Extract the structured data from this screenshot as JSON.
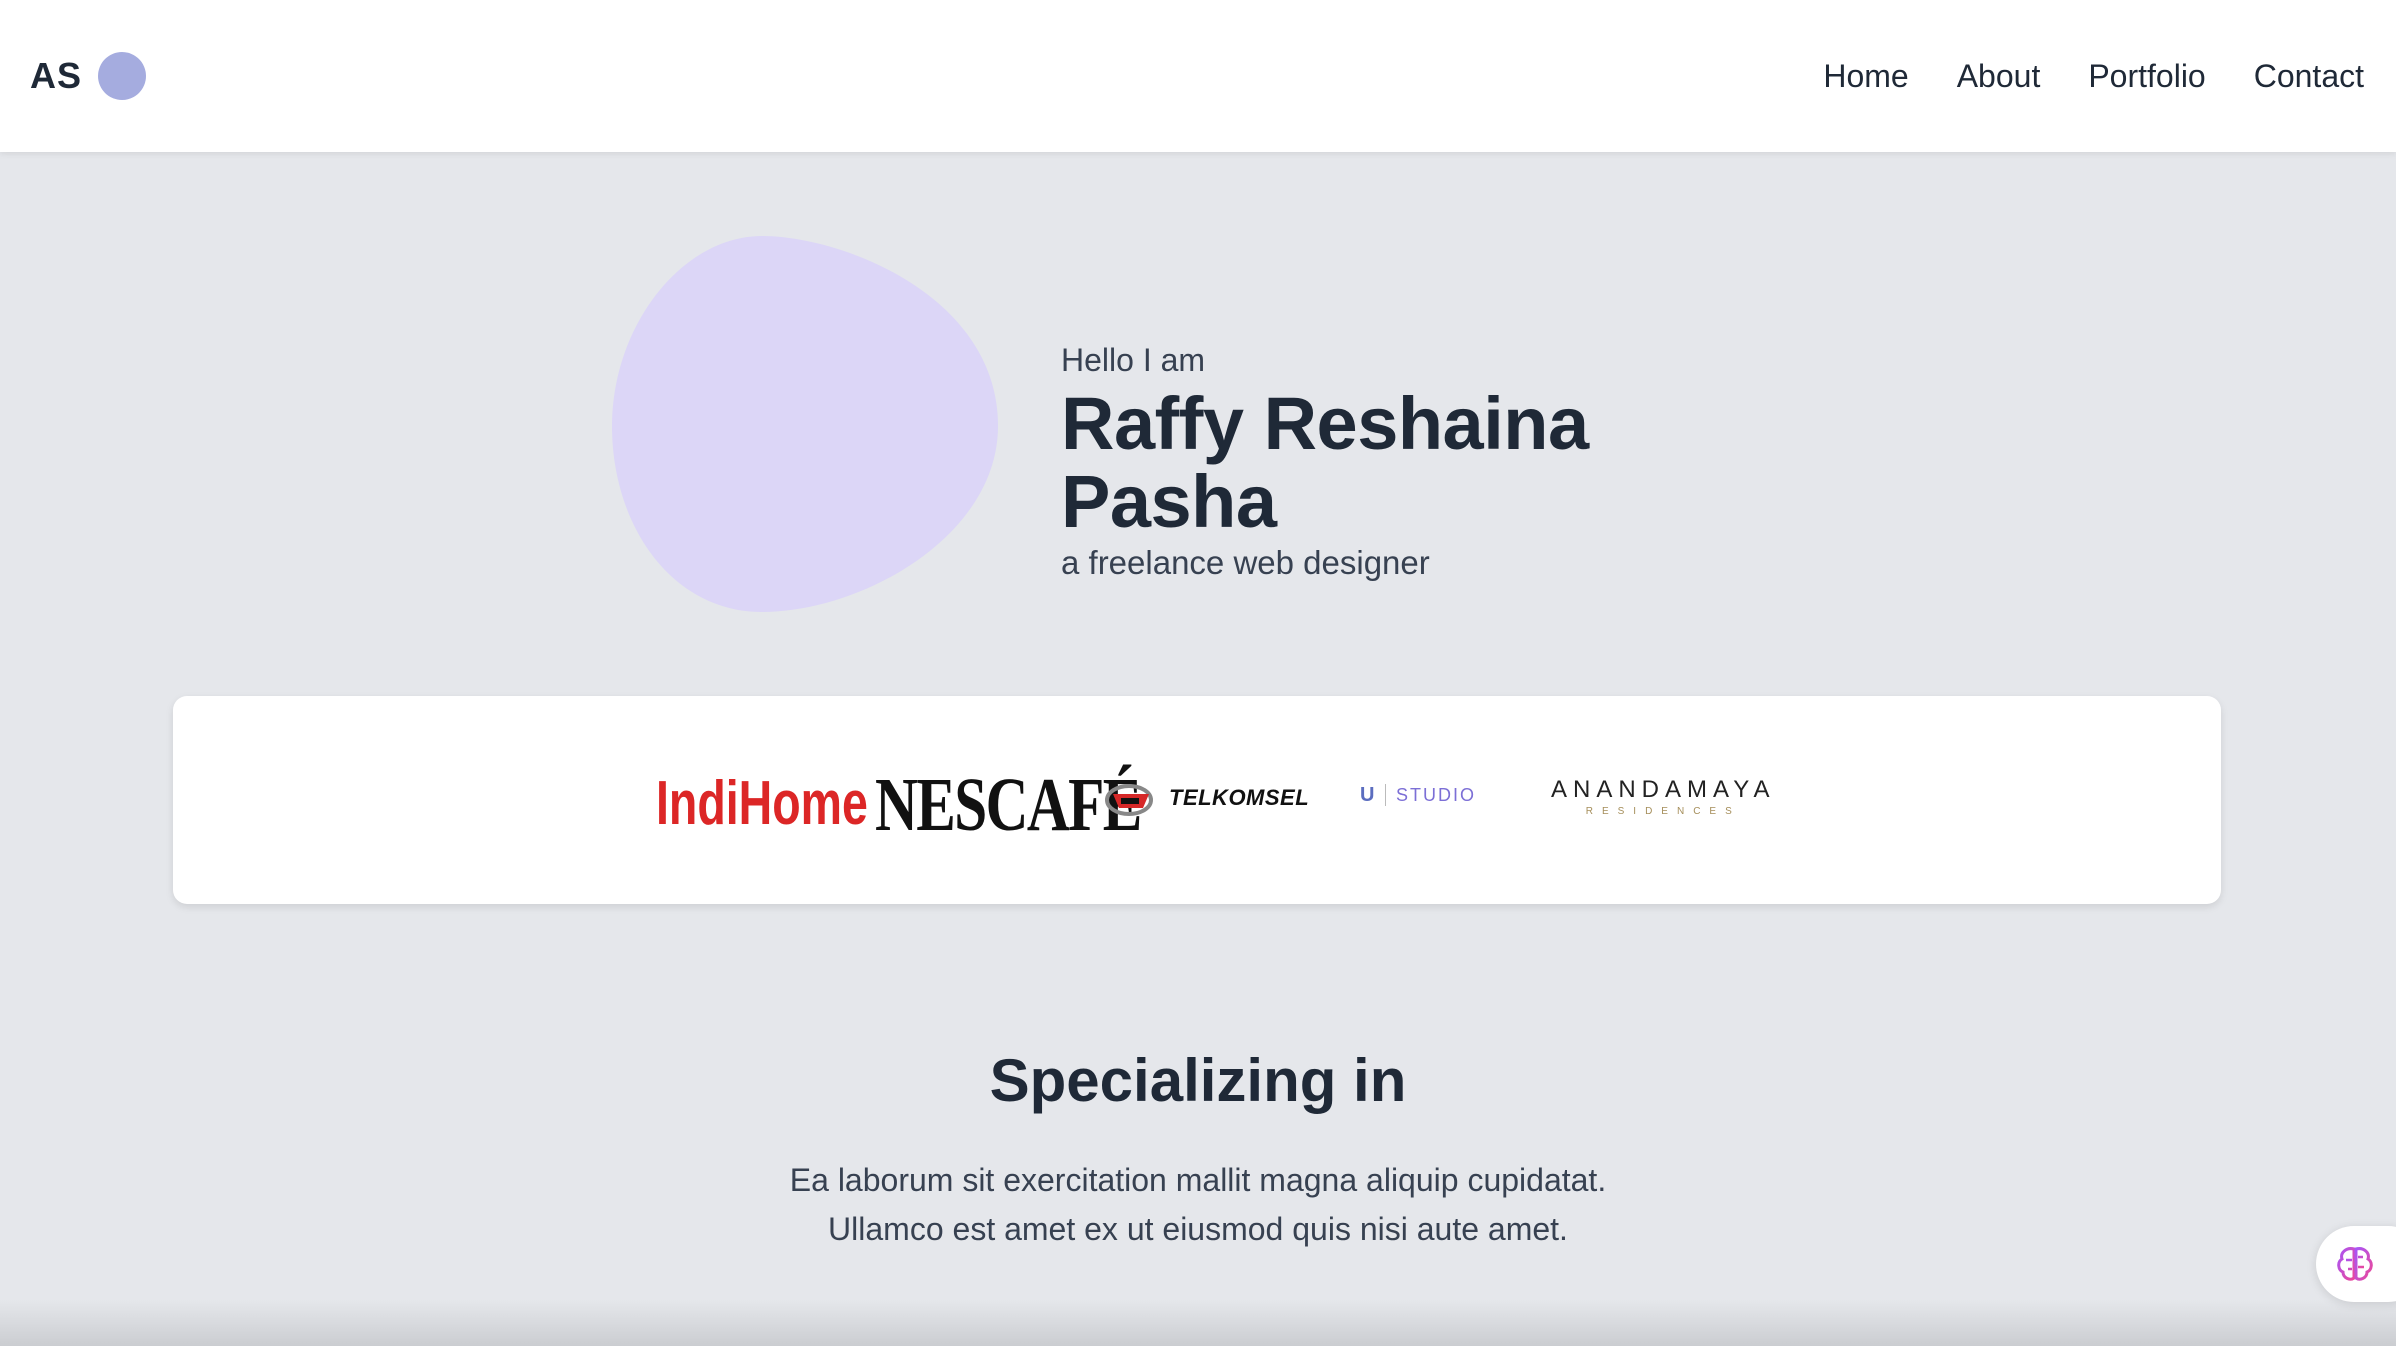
{
  "navbar": {
    "brand": "AS",
    "links": [
      "Home",
      "About",
      "Portfolio",
      "Contact"
    ]
  },
  "hero": {
    "greeting": "Hello I am",
    "name": "Raffy Reshaina Pasha",
    "role": "a freelance web designer"
  },
  "clients": {
    "logos": [
      {
        "name": "IndiHome",
        "icon": "indihome-logo"
      },
      {
        "name": "NESCAFÉ",
        "icon": "nescafe-logo"
      },
      {
        "name": "TELKOMSEL",
        "icon": "telkomsel-logo"
      },
      {
        "name": "STUDIO",
        "icon": "unilever-studio-logo"
      },
      {
        "name": "ANANDAMAYA",
        "sub": "RESIDENCES",
        "icon": "anandamaya-logo"
      }
    ]
  },
  "specializing": {
    "title": "Specializing in",
    "line1": "Ea laborum sit exercitation mallit magna aliquip cupidatat.",
    "line2": "Ullamco est amet ex ut eiusmod quis nisi aute amet."
  },
  "colors": {
    "background": "#e5e7eb",
    "blob": "#dcd6f7",
    "brand_dot": "#a5acdf",
    "text": "#1f2937"
  },
  "assistant": {
    "icon": "brain-icon"
  }
}
